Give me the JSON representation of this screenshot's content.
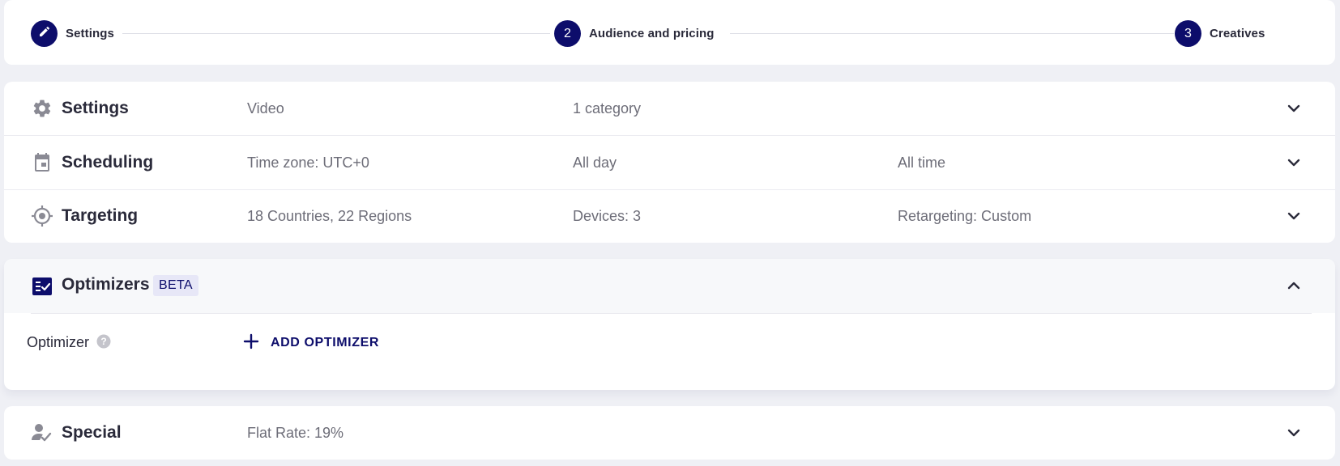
{
  "stepper": {
    "steps": [
      {
        "marker": "",
        "icon": "pencil-icon",
        "label": "Settings"
      },
      {
        "marker": "2",
        "label": "Audience and pricing"
      },
      {
        "marker": "3",
        "label": "Creatives"
      }
    ]
  },
  "summary": {
    "rows": [
      {
        "icon": "gear-icon",
        "title": "Settings",
        "col1": "Video",
        "col2": "1 category",
        "col3": ""
      },
      {
        "icon": "calendar-icon",
        "title": "Scheduling",
        "col1": "Time zone: UTC+0",
        "col2": "All day",
        "col3": "All time"
      },
      {
        "icon": "target-icon",
        "title": "Targeting",
        "col1": "18 Countries, 22 Regions",
        "col2": "Devices: 3",
        "col3": "Retargeting: Custom"
      }
    ]
  },
  "optimizers": {
    "icon": "checklist-icon",
    "title": "Optimizers",
    "badge": "BETA",
    "field_label": "Optimizer",
    "add_label": "ADD OPTIMIZER"
  },
  "special": {
    "icon": "person-check-icon",
    "title": "Special",
    "col1": "Flat Rate: 19%"
  },
  "colors": {
    "accent": "#0d0d6b",
    "background": "#eff0f5",
    "muted_text": "#6d6d78"
  }
}
